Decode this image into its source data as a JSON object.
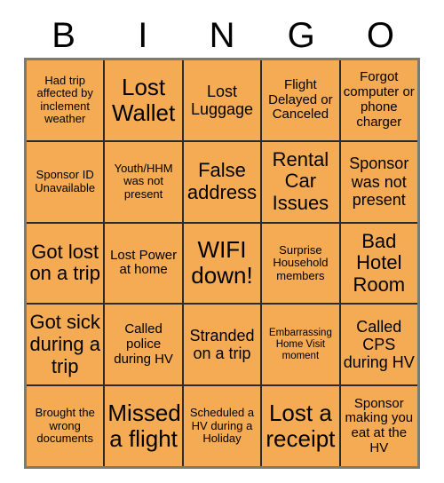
{
  "card": {
    "header_letters": [
      "B",
      "I",
      "N",
      "G",
      "O"
    ],
    "colors": {
      "cell_fill": "#f5ab54",
      "grid_line": "#2b2b2b",
      "outer_border": "#7b7b72",
      "text": "#000000",
      "background": "#ffffff"
    },
    "rows": [
      [
        {
          "text": "Had trip affected by inclement weather",
          "size": "sm"
        },
        {
          "text": "Lost Wallet",
          "size": "xxl"
        },
        {
          "text": "Lost Luggage",
          "size": "lg"
        },
        {
          "text": "Flight Delayed or Canceled",
          "size": "md"
        },
        {
          "text": "Forgot computer or phone charger",
          "size": "md"
        }
      ],
      [
        {
          "text": "Sponsor ID Unavailable",
          "size": "sm"
        },
        {
          "text": "Youth/HHM was not present",
          "size": "sm"
        },
        {
          "text": "False address",
          "size": "xl"
        },
        {
          "text": "Rental Car Issues",
          "size": "xl"
        },
        {
          "text": "Sponsor was not present",
          "size": "lg"
        }
      ],
      [
        {
          "text": "Got lost on a trip",
          "size": "xl"
        },
        {
          "text": "Lost Power at home",
          "size": "md"
        },
        {
          "text": "WIFI down!",
          "size": "xxl"
        },
        {
          "text": "Surprise Household members",
          "size": "sm"
        },
        {
          "text": "Bad Hotel Room",
          "size": "xl"
        }
      ],
      [
        {
          "text": "Got sick during a trip",
          "size": "xl"
        },
        {
          "text": "Called police during HV",
          "size": "md"
        },
        {
          "text": "Stranded on a trip",
          "size": "lg"
        },
        {
          "text": "Embarrassing Home Visit moment",
          "size": "xs"
        },
        {
          "text": "Called CPS during HV",
          "size": "lg"
        }
      ],
      [
        {
          "text": "Brought the wrong documents",
          "size": "sm"
        },
        {
          "text": "Missed a flight",
          "size": "xxl"
        },
        {
          "text": "Scheduled a HV during a Holiday",
          "size": "sm"
        },
        {
          "text": "Lost a receipt",
          "size": "xxl"
        },
        {
          "text": "Sponsor making you eat at the HV",
          "size": "md"
        }
      ]
    ]
  }
}
